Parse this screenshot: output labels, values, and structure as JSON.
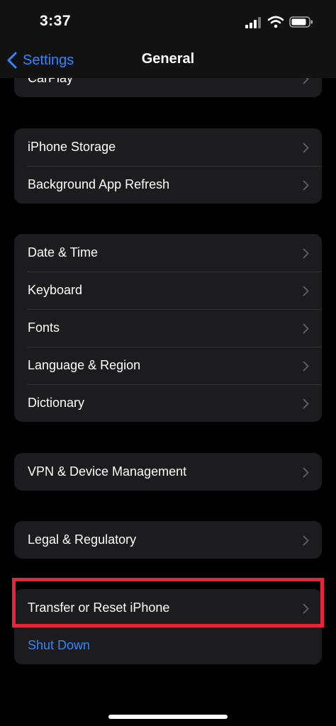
{
  "status_bar": {
    "time": "3:37",
    "signal_icon": "cellular-signal-icon",
    "wifi_icon": "wifi-icon",
    "battery_icon": "battery-icon"
  },
  "nav": {
    "back_label": "Settings",
    "title": "General"
  },
  "groups": [
    {
      "rows": [
        {
          "label": "CarPlay"
        }
      ]
    },
    {
      "rows": [
        {
          "label": "iPhone Storage"
        },
        {
          "label": "Background App Refresh"
        }
      ]
    },
    {
      "rows": [
        {
          "label": "Date & Time"
        },
        {
          "label": "Keyboard"
        },
        {
          "label": "Fonts"
        },
        {
          "label": "Language & Region"
        },
        {
          "label": "Dictionary"
        }
      ]
    },
    {
      "rows": [
        {
          "label": "VPN & Device Management"
        }
      ]
    },
    {
      "rows": [
        {
          "label": "Legal & Regulatory"
        }
      ]
    },
    {
      "rows": [
        {
          "label": "Transfer or Reset iPhone"
        },
        {
          "label": "Shut Down"
        }
      ]
    }
  ],
  "colors": {
    "background": "#000000",
    "cell": "#1c1c1e",
    "accent": "#2f86ff",
    "highlight": "#e8243c"
  }
}
